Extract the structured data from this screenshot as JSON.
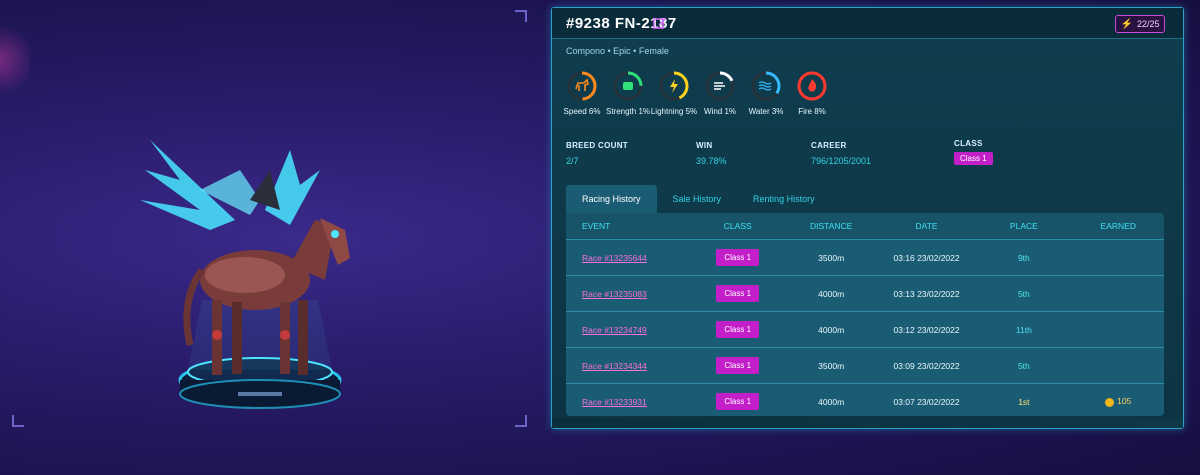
{
  "horse": {
    "id_title": "#9238 FN-2187",
    "breed_line": "Compono • Epic • Female",
    "energy": "22/25"
  },
  "stats": [
    {
      "label": "Speed",
      "value": "6%",
      "color": "#ff8a1f",
      "icon": "horse-icon"
    },
    {
      "label": "Strength",
      "value": "1%",
      "color": "#2fe07a",
      "icon": "fist-icon"
    },
    {
      "label": "Lightning",
      "value": "5%",
      "color": "#ffd21f",
      "icon": "bolt-icon"
    },
    {
      "label": "Wind",
      "value": "1%",
      "color": "#ffffff",
      "icon": "wind-icon"
    },
    {
      "label": "Water",
      "value": "3%",
      "color": "#35b9ff",
      "icon": "water-icon"
    },
    {
      "label": "Fire",
      "value": "8%",
      "color": "#ff3b2f",
      "icon": "fire-icon"
    }
  ],
  "info": {
    "breed_count_label": "BREED COUNT",
    "breed_count": "2/7",
    "win_label": "WIN",
    "win": "39.78%",
    "career_label": "CAREER",
    "career": "796/1205/2001",
    "class_label": "CLASS",
    "class": "Class 1"
  },
  "tabs": [
    "Racing History",
    "Sale History",
    "Renting History"
  ],
  "table": {
    "headers": [
      "EVENT",
      "CLASS",
      "DISTANCE",
      "DATE",
      "PLACE",
      "EARNED"
    ],
    "rows": [
      {
        "event": "Race #13235644",
        "class": "Class 1",
        "distance": "3500m",
        "date": "03:16 23/02/2022",
        "place": "9th",
        "earned": ""
      },
      {
        "event": "Race #13235083",
        "class": "Class 1",
        "distance": "4000m",
        "date": "03:13 23/02/2022",
        "place": "5th",
        "earned": ""
      },
      {
        "event": "Race #13234749",
        "class": "Class 1",
        "distance": "4000m",
        "date": "03:12 23/02/2022",
        "place": "11th",
        "earned": ""
      },
      {
        "event": "Race #13234344",
        "class": "Class 1",
        "distance": "3500m",
        "date": "03:09 23/02/2022",
        "place": "5th",
        "earned": ""
      },
      {
        "event": "Race #13233931",
        "class": "Class 1",
        "distance": "4000m",
        "date": "03:07 23/02/2022",
        "place": "1st",
        "earned": "105"
      }
    ]
  }
}
